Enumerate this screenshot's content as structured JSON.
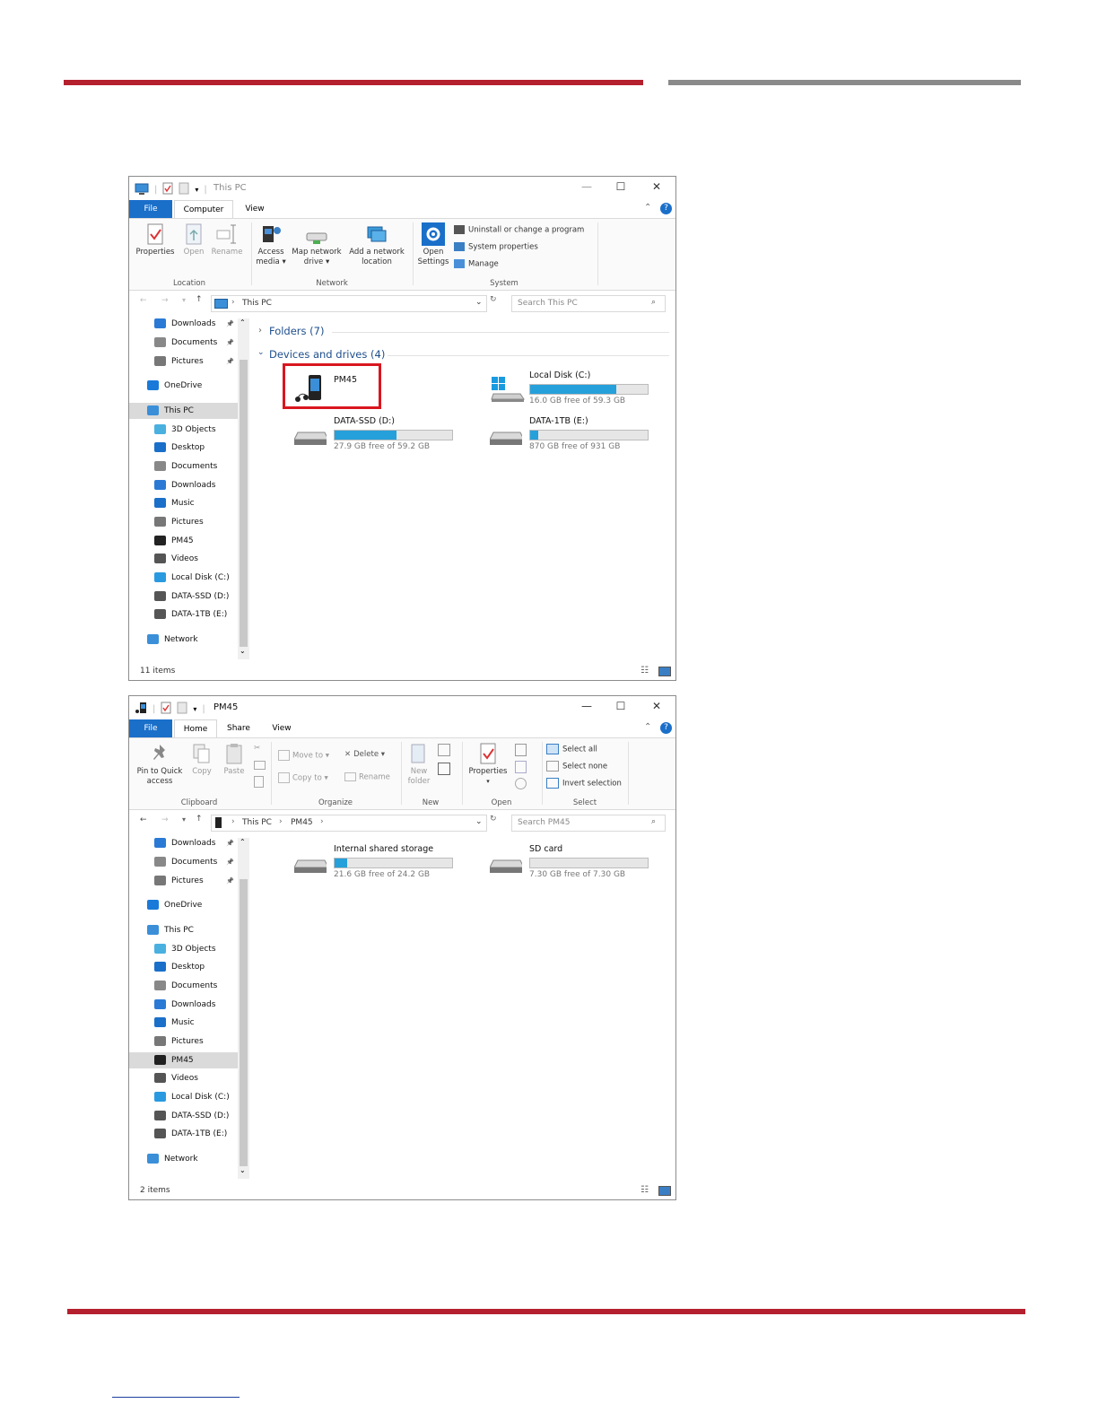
{
  "win1": {
    "title": "This PC",
    "tabs": {
      "file": "File",
      "computer": "Computer",
      "view": "View"
    },
    "ribbon": {
      "properties": "Properties",
      "open": "Open",
      "rename": "Rename",
      "access_media_1": "Access",
      "access_media_2": "media ▾",
      "map_drive_1": "Map network",
      "map_drive_2": "drive ▾",
      "add_loc_1": "Add a network",
      "add_loc_2": "location",
      "open_settings_1": "Open",
      "open_settings_2": "Settings",
      "uninstall": "Uninstall or change a program",
      "sys_props": "System properties",
      "manage": "Manage",
      "group_location": "Location",
      "group_network": "Network",
      "group_system": "System"
    },
    "address": {
      "path": "This PC",
      "search_placeholder": "Search This PC"
    },
    "nav": [
      "Downloads",
      "Documents",
      "Pictures",
      "OneDrive",
      "This PC",
      "3D Objects",
      "Desktop",
      "Documents",
      "Downloads",
      "Music",
      "Pictures",
      "PM45",
      "Videos",
      "Local Disk (C:)",
      "DATA-SSD (D:)",
      "DATA-1TB (E:)",
      "Network"
    ],
    "sections": {
      "folders": "Folders (7)",
      "devices": "Devices and drives (4)"
    },
    "drives": [
      {
        "label": "PM45",
        "free": "",
        "fill": 0
      },
      {
        "label": "Local Disk (C:)",
        "free": "16.0 GB free of 59.3 GB",
        "fill": 0.73
      },
      {
        "label": "DATA-SSD (D:)",
        "free": "27.9 GB free of 59.2 GB",
        "fill": 0.53
      },
      {
        "label": "DATA-1TB (E:)",
        "free": "870 GB free of 931 GB",
        "fill": 0.07
      }
    ],
    "status": "11 items"
  },
  "win2": {
    "title": "PM45",
    "tabs": {
      "file": "File",
      "home": "Home",
      "share": "Share",
      "view": "View"
    },
    "ribbon": {
      "pin_1": "Pin to Quick",
      "pin_2": "access",
      "copy": "Copy",
      "paste": "Paste",
      "move_to": "Move to ▾",
      "delete": "Delete ▾",
      "copy_to": "Copy to ▾",
      "rename": "Rename",
      "new_folder_1": "New",
      "new_folder_2": "folder",
      "properties": "Properties",
      "select_all": "Select all",
      "select_none": "Select none",
      "invert": "Invert selection",
      "group_clipboard": "Clipboard",
      "group_organize": "Organize",
      "group_new": "New",
      "group_open": "Open",
      "group_select": "Select"
    },
    "address": {
      "path1": "This PC",
      "path2": "PM45",
      "search_placeholder": "Search PM45"
    },
    "nav": [
      "Downloads",
      "Documents",
      "Pictures",
      "OneDrive",
      "This PC",
      "3D Objects",
      "Desktop",
      "Documents",
      "Downloads",
      "Music",
      "Pictures",
      "PM45",
      "Videos",
      "Local Disk (C:)",
      "DATA-SSD (D:)",
      "DATA-1TB (E:)",
      "Network"
    ],
    "storages": [
      {
        "label": "Internal shared storage",
        "free": "21.6 GB free of 24.2 GB",
        "fill": 0.11
      },
      {
        "label": "SD card",
        "free": "7.30 GB free of 7.30 GB",
        "fill": 0.0
      }
    ],
    "status": "2 items"
  },
  "colors": {
    "accent": "#1a6fc9",
    "brand_red": "#b5202e",
    "bar_fill": "#26a0da",
    "highlight": "#d9161f"
  }
}
